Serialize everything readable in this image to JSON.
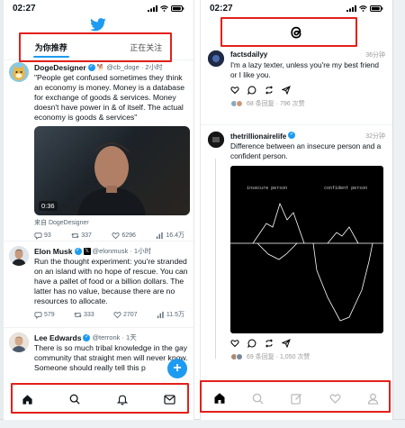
{
  "left_phone": {
    "status_time": "02:27",
    "tabs": [
      {
        "label": "为你推荐",
        "active": true
      },
      {
        "label": "正在关注",
        "active": false
      }
    ],
    "tweets": [
      {
        "name": "DogeDesigner",
        "handle": "@cb_doge · 2小时",
        "text": "\"People get confused sometimes they think an economy is money. Money is a database for exchange of goods & services. Money doesn't have power in & of itself. The actual economy is goods & services\"",
        "media_duration": "0:36",
        "from": "来自 DogeDesigner",
        "stats": {
          "replies": "93",
          "retweets": "337",
          "likes": "6296",
          "views": "16.4万"
        }
      },
      {
        "name": "Elon Musk",
        "handle": "@elonmusk · 1小时",
        "text": "Run the thought experiment: you're stranded on an island with no hope of rescue. You can have a pallet of food or a billion dollars. The latter has no value, because there are no resources to allocate.",
        "stats": {
          "replies": "579",
          "retweets": "333",
          "likes": "2707",
          "views": "11.5万"
        }
      },
      {
        "name": "Lee Edwards",
        "handle": "@terronk · 1天",
        "text": "There is so much tribal knowledge in the gay community that straight men will never know. Someone should really tell this p"
      }
    ],
    "fab_label": "+"
  },
  "right_phone": {
    "status_time": "02:27",
    "threads": [
      {
        "name": "factsdailyy",
        "time": "36分钟",
        "text": "I'm a lazy texter, unless you're my best friend or I like you.",
        "stats": "68 条回复 · 796 次赞"
      },
      {
        "name": "thetrillionairelife",
        "time": "32分钟",
        "text": "Difference between an insecure person and a confident person.",
        "image_labels": {
          "left": "insecure person",
          "right": "confident person"
        },
        "stats": "69 条回复 · 1,050 次赞"
      }
    ]
  },
  "colors": {
    "twitter_blue": "#1d9bf0",
    "highlight_red": "#e3201b",
    "text_dark": "#0f1419",
    "text_muted": "#536471"
  },
  "icons": {
    "left_nav": [
      "home-icon",
      "search-icon",
      "notifications-icon",
      "messages-icon"
    ],
    "right_nav": [
      "home-icon",
      "search-icon",
      "compose-icon",
      "heart-icon",
      "profile-icon"
    ]
  }
}
